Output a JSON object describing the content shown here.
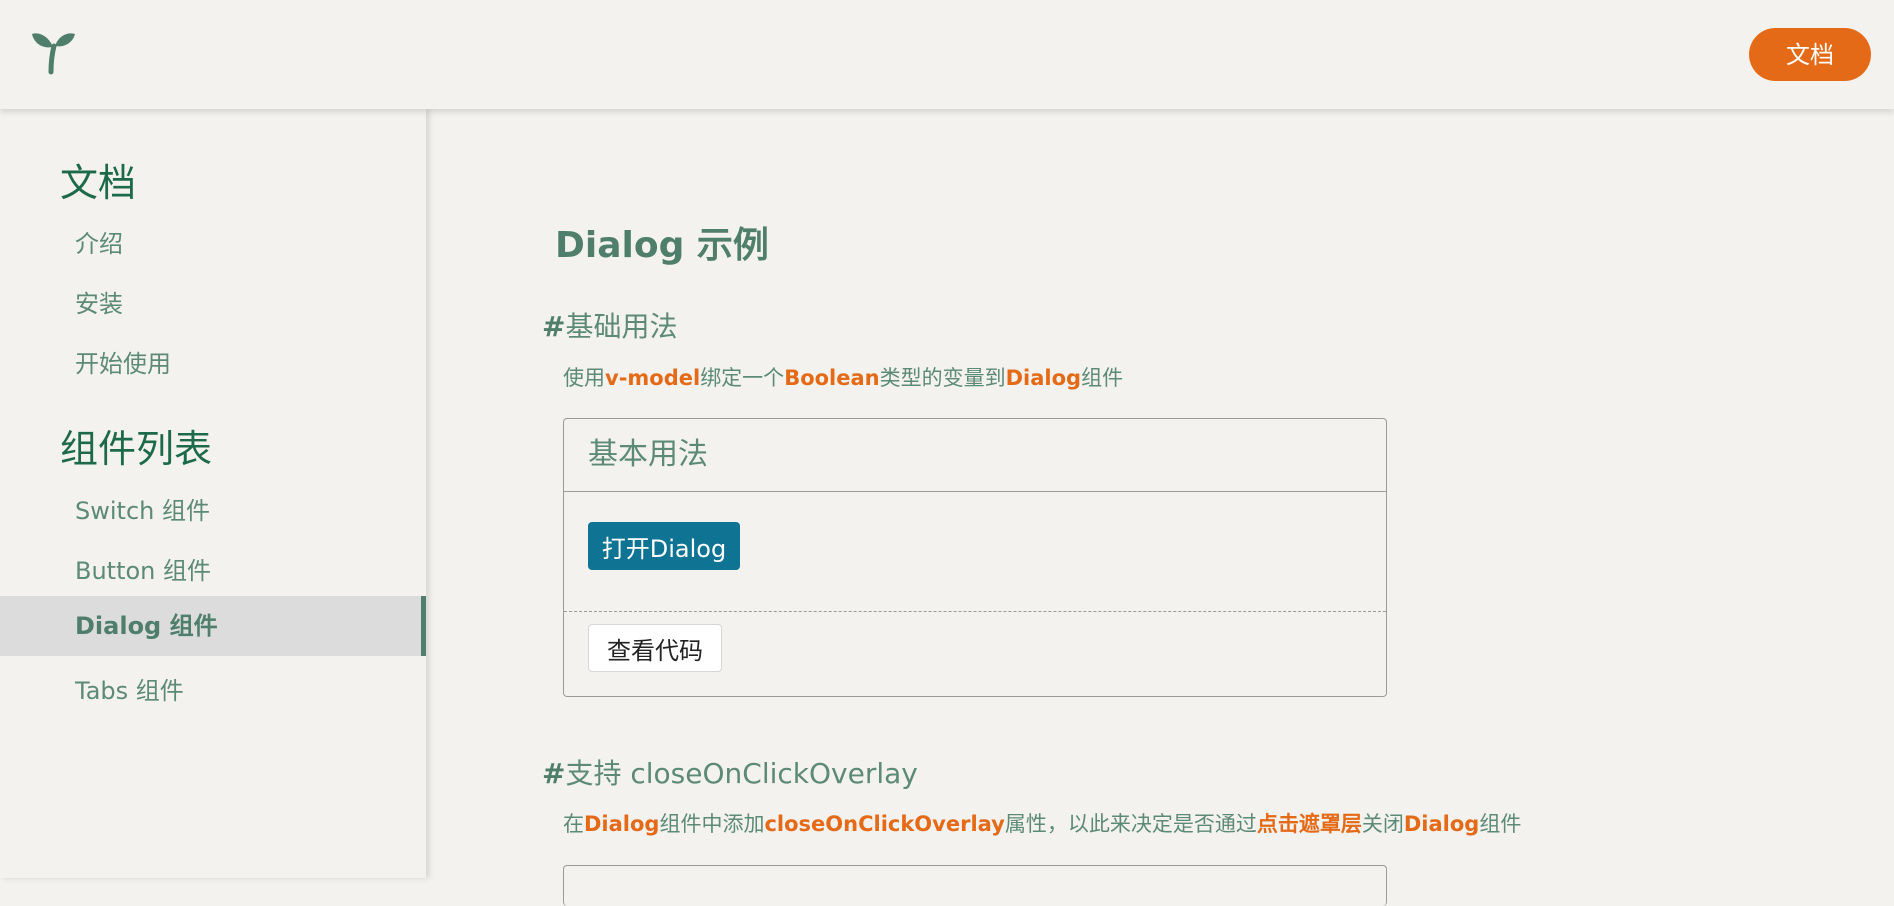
{
  "header": {
    "logo_icon": "sprout-icon",
    "docs_button_label": "文档",
    "accent_color": "#e46a17"
  },
  "sidebar": {
    "docs_heading": "文档",
    "docs_items": [
      {
        "label": "介绍"
      },
      {
        "label": "安装"
      },
      {
        "label": "开始使用"
      }
    ],
    "components_heading": "组件列表",
    "component_items": [
      {
        "label": "Switch 组件"
      },
      {
        "label": "Button 组件"
      },
      {
        "label": "Dialog 组件",
        "active": true
      },
      {
        "label": "Tabs 组件"
      }
    ]
  },
  "main": {
    "page_title": "Dialog 示例",
    "sections": [
      {
        "hash": "#",
        "title": "基础用法",
        "desc": [
          {
            "text": "使用"
          },
          {
            "text": "v-model",
            "highlight": true
          },
          {
            "text": "绑定一个"
          },
          {
            "text": "Boolean",
            "highlight": true
          },
          {
            "text": "类型的变量到"
          },
          {
            "text": "Dialog",
            "highlight": true
          },
          {
            "text": "组件"
          }
        ],
        "card": {
          "title": "基本用法",
          "open_button_label": "打开Dialog",
          "view_code_label": "查看代码"
        }
      },
      {
        "hash": "#",
        "title": "支持 closeOnClickOverlay",
        "desc": [
          {
            "text": "在"
          },
          {
            "text": "Dialog",
            "highlight": true
          },
          {
            "text": "组件中添加"
          },
          {
            "text": "closeOnClickOverlay",
            "highlight": true
          },
          {
            "text": "属性，以此来决定是否通过"
          },
          {
            "text": "点击遮罩层",
            "highlight": true
          },
          {
            "text": "关闭"
          },
          {
            "text": "Dialog",
            "highlight": true
          },
          {
            "text": "组件"
          }
        ]
      }
    ]
  },
  "colors": {
    "background": "#f4f2ee",
    "text_green": "#4f7f6c",
    "heading_green": "#1d6a4a",
    "primary_button": "#0f7393",
    "highlight": "#e46a17"
  }
}
